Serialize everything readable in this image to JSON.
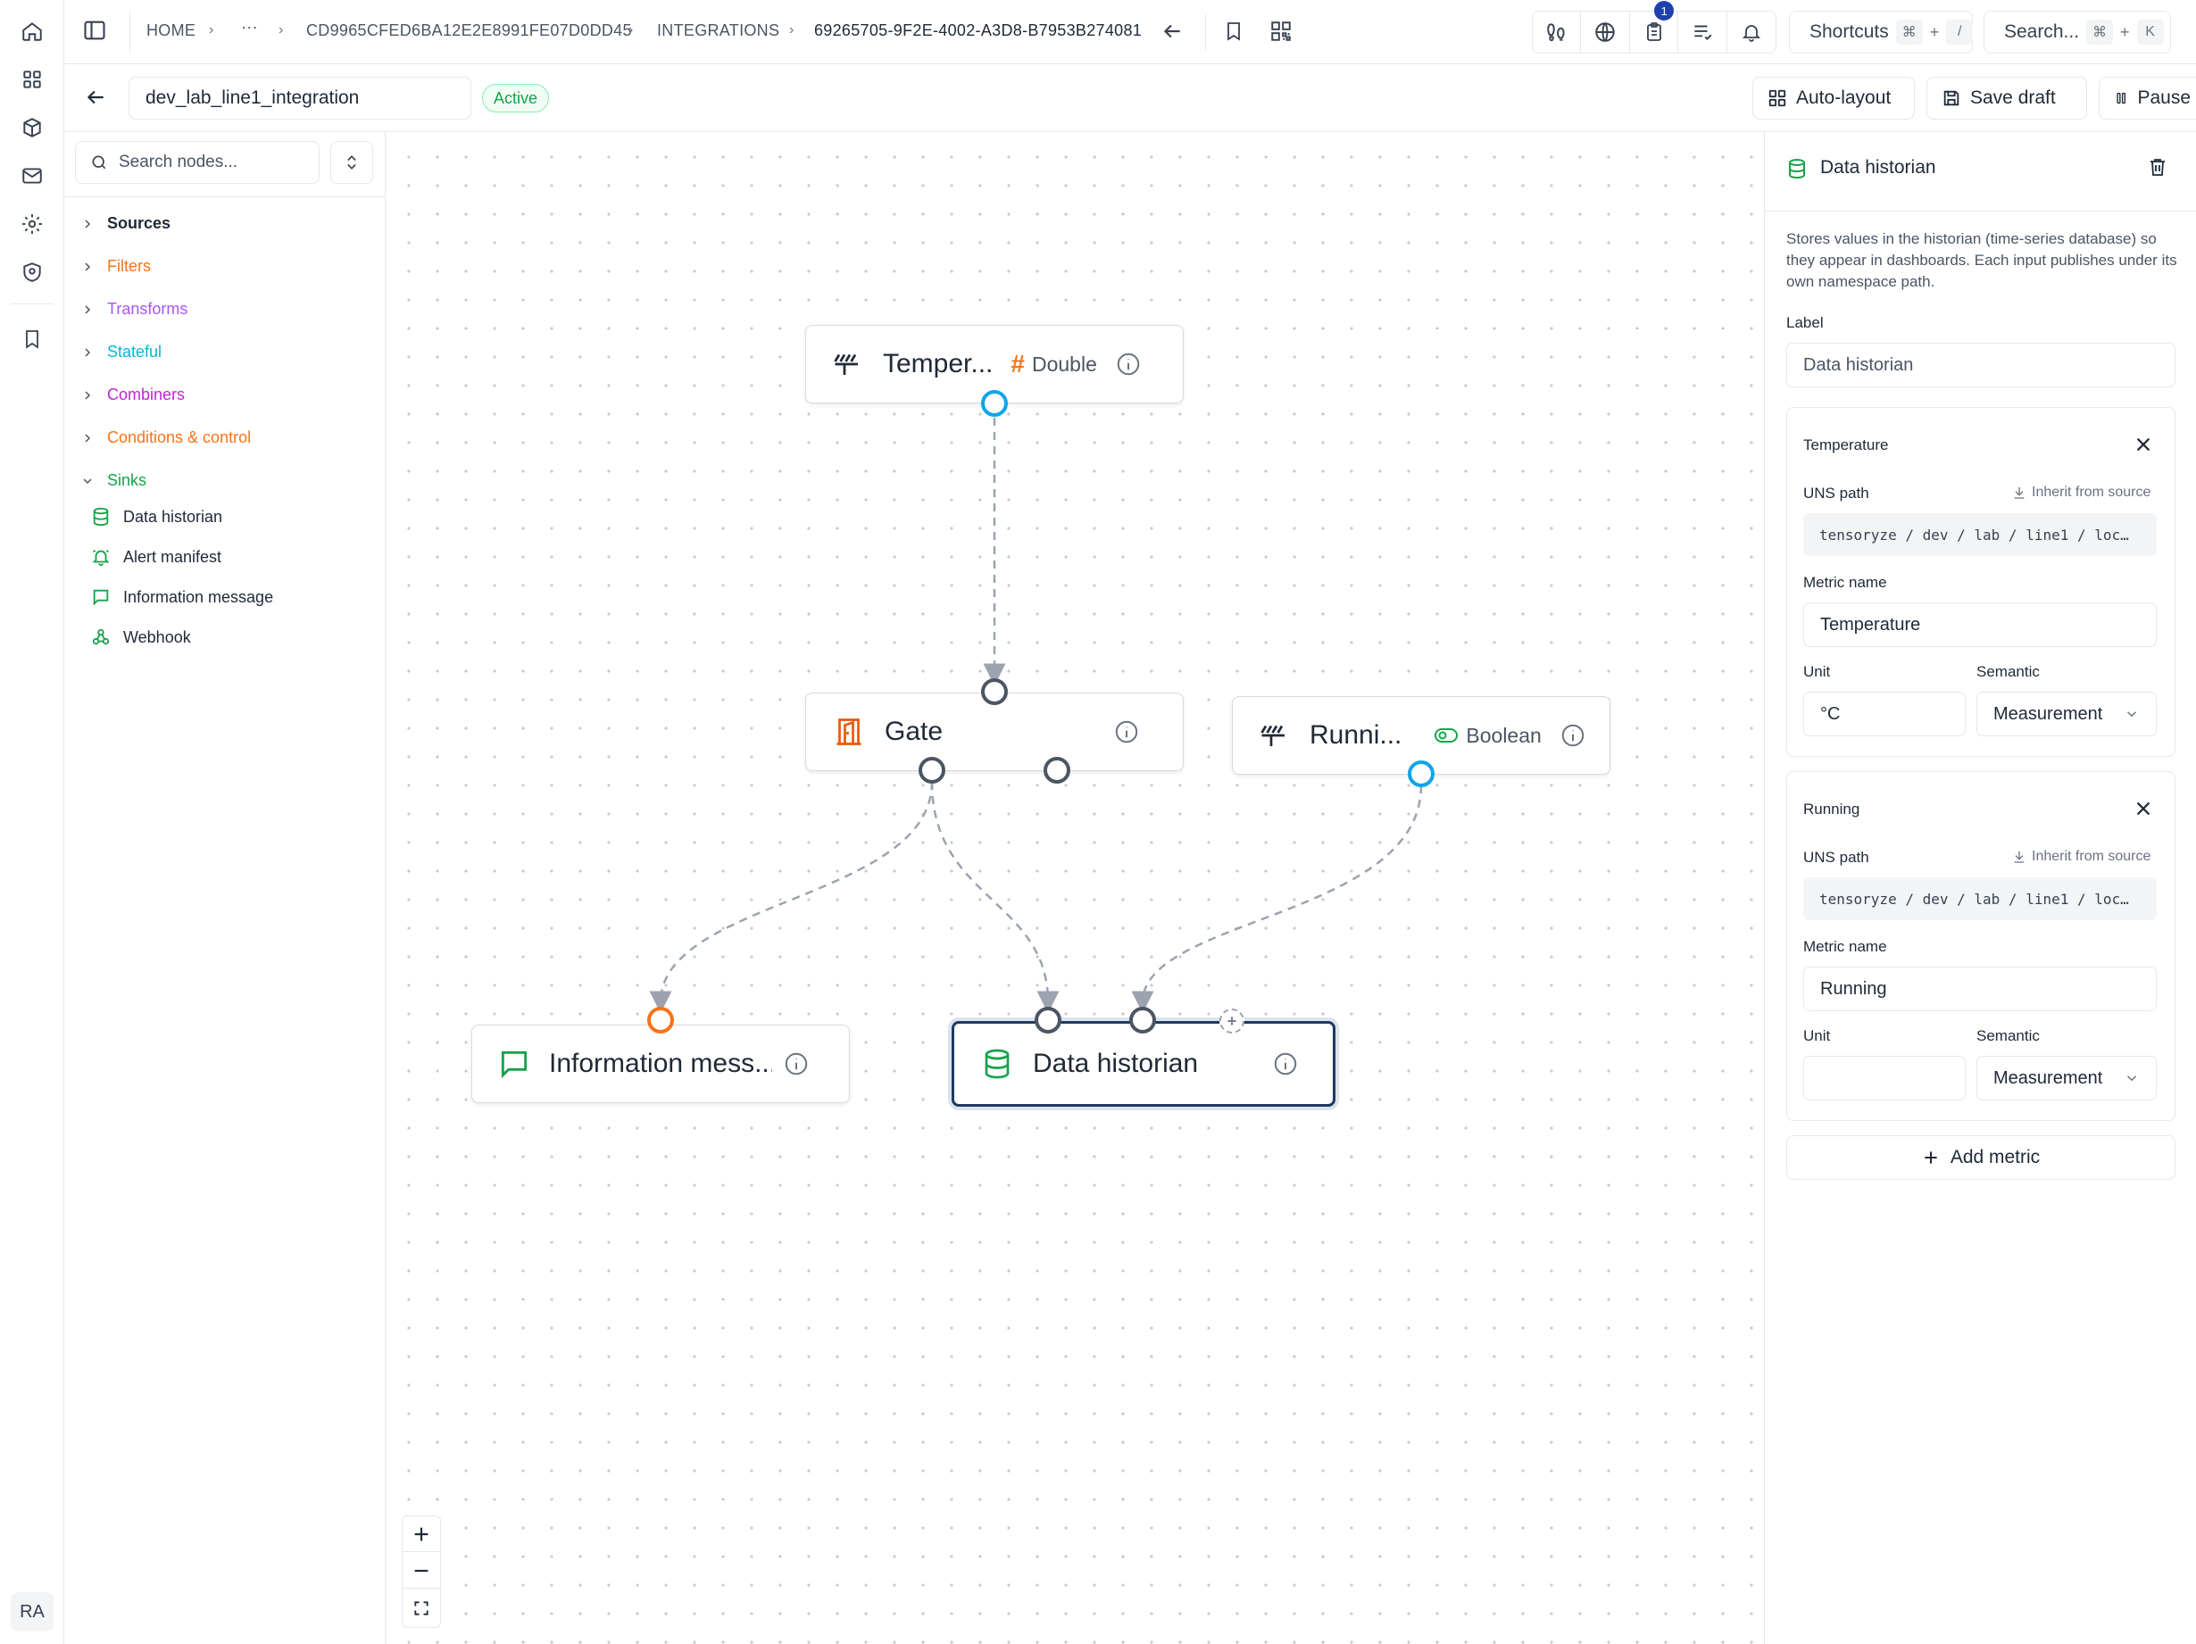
{
  "rail": {
    "items": [
      "home-icon",
      "grid-icon",
      "cube-icon",
      "mail-icon",
      "settings-icon",
      "shield-icon",
      "bookmark-icon"
    ],
    "avatar": "RA"
  },
  "topbar": {
    "breadcrumb": [
      "HOME",
      "CD9965CFED6BA12E2E8991FE07D0DD45",
      "INTEGRATIONS",
      "69265705-9F2E-4002-A3D8-B7953B274081"
    ],
    "ellipsis": "···",
    "notif_count": "1",
    "shortcuts_label": "Shortcuts",
    "shortcuts_key1": "⌘",
    "shortcuts_plus": "+",
    "shortcuts_key2": "/",
    "search_label": "Search...",
    "search_key1": "⌘",
    "search_plus": "+",
    "search_key2": "K"
  },
  "editor": {
    "integration_name": "dev_lab_line1_integration",
    "status": "Active",
    "auto_layout": "Auto-layout",
    "save_draft": "Save draft",
    "pause": "Pause"
  },
  "palette": {
    "search_placeholder": "Search nodes...",
    "categories": [
      {
        "label": "Sources",
        "color": "#1f2937"
      },
      {
        "label": "Filters",
        "color": "#f97316"
      },
      {
        "label": "Transforms",
        "color": "#a855f7"
      },
      {
        "label": "Stateful",
        "color": "#06b6d4"
      },
      {
        "label": "Combiners",
        "color": "#c026d3"
      },
      {
        "label": "Conditions & control",
        "color": "#f97316"
      },
      {
        "label": "Sinks",
        "color": "#16a34a"
      }
    ],
    "sinks": [
      {
        "label": "Data historian",
        "icon": "database-icon"
      },
      {
        "label": "Alert manifest",
        "icon": "bell-icon"
      },
      {
        "label": "Information message",
        "icon": "message-icon"
      },
      {
        "label": "Webhook",
        "icon": "webhook-icon"
      }
    ]
  },
  "canvas": {
    "nodes": {
      "temperature": {
        "title": "Temper...",
        "type": "Double"
      },
      "gate": {
        "title": "Gate"
      },
      "running": {
        "title": "Runni...",
        "type": "Boolean"
      },
      "info": {
        "title": "Information mess..."
      },
      "historian": {
        "title": "Data historian"
      }
    }
  },
  "panel": {
    "title": "Data historian",
    "description": "Stores values in the historian (time-series database) so they appear in dashboards. Each input publishes under its own namespace path.",
    "label_label": "Label",
    "label_value": "Data historian",
    "metrics": [
      {
        "header": "Temperature",
        "uns_label": "UNS path",
        "inherit": "Inherit from source",
        "uns_value": "tensoryze / dev / lab / line1 / loc…",
        "metric_label": "Metric name",
        "metric_value": "Temperature",
        "unit_label": "Unit",
        "unit_value": "°C",
        "semantic_label": "Semantic",
        "semantic_value": "Measurement"
      },
      {
        "header": "Running",
        "uns_label": "UNS path",
        "inherit": "Inherit from source",
        "uns_value": "tensoryze / dev / lab / line1 / loc…",
        "metric_label": "Metric name",
        "metric_value": "Running",
        "unit_label": "Unit",
        "unit_value": "",
        "semantic_label": "Semantic",
        "semantic_value": "Measurement"
      }
    ],
    "add_metric": "Add metric"
  }
}
